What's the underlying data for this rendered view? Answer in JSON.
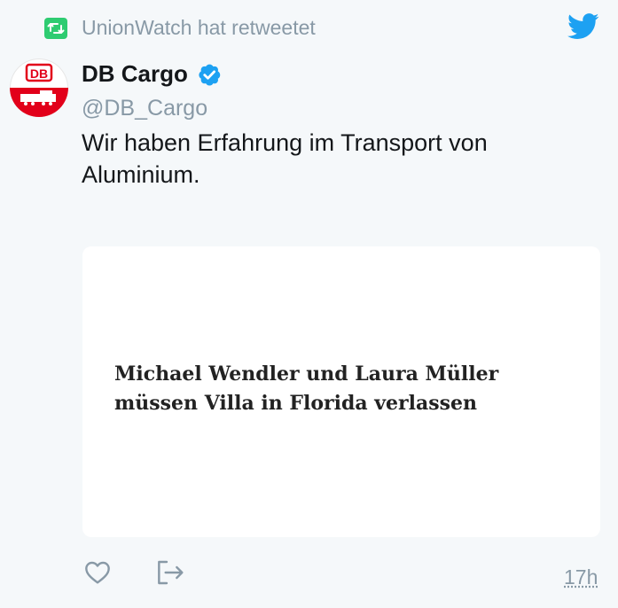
{
  "retweet": {
    "text": "UnionWatch hat retweetet"
  },
  "author": {
    "name": "DB Cargo",
    "handle": "@DB_Cargo",
    "logo_text": "DB"
  },
  "tweet": {
    "text": "Wir haben Erfahrung im Transport von Aluminium."
  },
  "card": {
    "headline": "Michael Wendler und Laura Müller müssen Villa in Florida verlassen"
  },
  "footer": {
    "time": "17h"
  },
  "colors": {
    "twitter_blue": "#1da1f2",
    "retweet_green": "#2ecc71",
    "db_red": "#e2001a",
    "muted": "#8899a6"
  },
  "icons": [
    "retweet-icon",
    "twitter-bird-icon",
    "verified-badge-icon",
    "heart-icon",
    "share-icon"
  ]
}
